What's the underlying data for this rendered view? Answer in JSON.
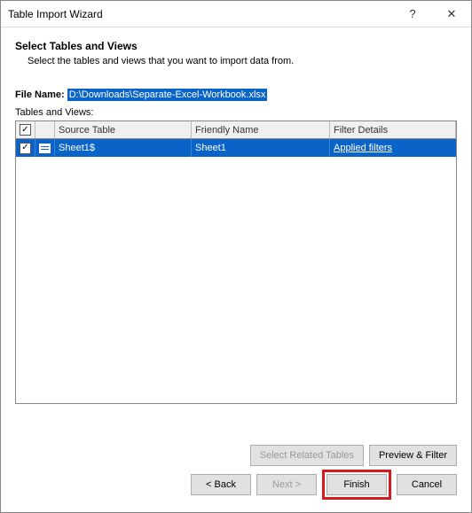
{
  "window": {
    "title": "Table Import Wizard"
  },
  "section": {
    "heading": "Select Tables and Views",
    "sub": "Select the tables and views that you want to import data from."
  },
  "file": {
    "label": "File Name:",
    "value": "D:\\Downloads\\Separate-Excel-Workbook.xlsx"
  },
  "grid": {
    "label": "Tables and Views:",
    "columns": {
      "source": "Source Table",
      "friendly": "Friendly Name",
      "filter": "Filter Details"
    },
    "rows": [
      {
        "checked": true,
        "source": "Sheet1$",
        "friendly": "Sheet1",
        "filter": "Applied filters"
      }
    ]
  },
  "buttons": {
    "select_related": "Select Related Tables",
    "preview_filter": "Preview & Filter",
    "back": "< Back",
    "next": "Next >",
    "finish": "Finish",
    "cancel": "Cancel"
  }
}
